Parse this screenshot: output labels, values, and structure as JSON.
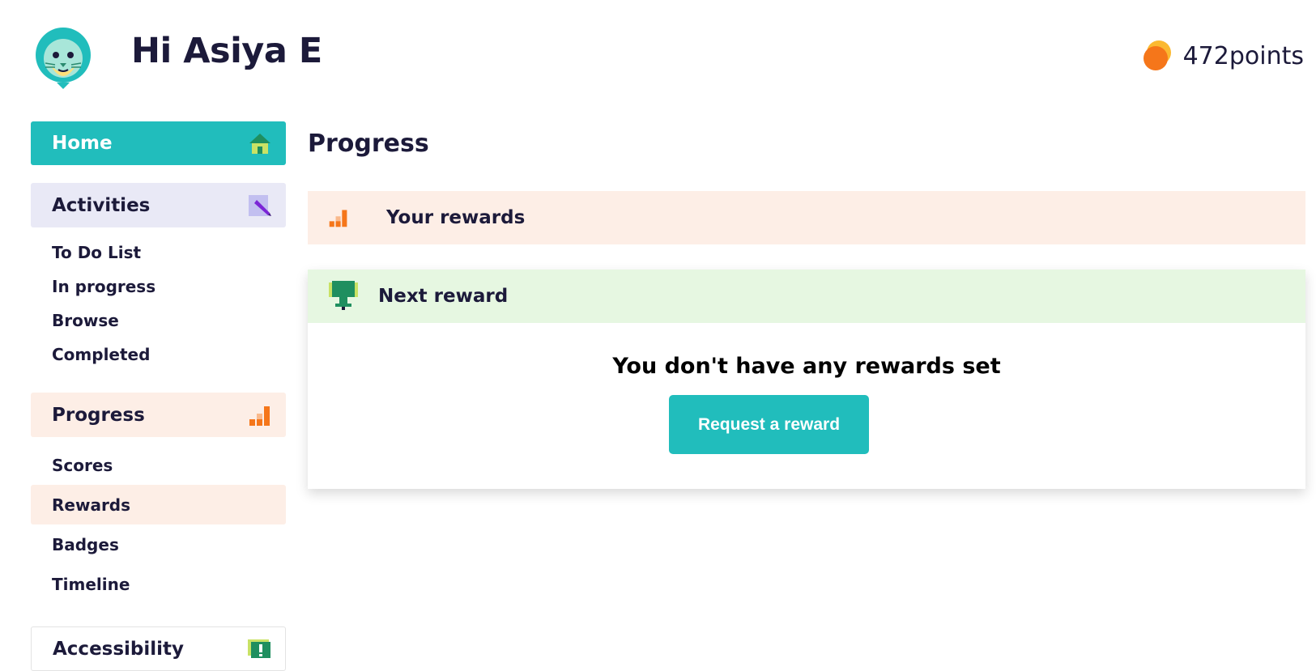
{
  "header": {
    "greeting": "Hi Asiya E",
    "points": "472points",
    "avatar_icon": "lion-avatar-icon",
    "points_icon": "coin-icon"
  },
  "sidebar": {
    "home": {
      "label": "Home",
      "icon": "house-icon"
    },
    "activities": {
      "label": "Activities",
      "icon": "pencil-icon",
      "items": [
        "To Do List",
        "In progress",
        "Browse",
        "Completed"
      ]
    },
    "progress": {
      "label": "Progress",
      "icon": "bar-chart-icon",
      "items": [
        "Scores",
        "Rewards",
        "Badges",
        "Timeline"
      ],
      "active_item": "Rewards"
    },
    "accessibility": {
      "label": "Accessibility",
      "icon": "exclamation-chat-icon"
    }
  },
  "main": {
    "title": "Progress",
    "your_rewards": {
      "label": "Your rewards",
      "icon": "bar-chart-icon"
    },
    "next_reward": {
      "label": "Next reward",
      "icon": "trophy-icon",
      "empty_message": "You don't have any rewards set",
      "button_label": "Request a reward"
    }
  },
  "colors": {
    "teal": "#21bdbc",
    "peach": "#fdeee6",
    "lavender": "#e9e9f6",
    "mint": "#e6f7e1",
    "text": "#1c1a3a",
    "orange": "#f5761a"
  }
}
